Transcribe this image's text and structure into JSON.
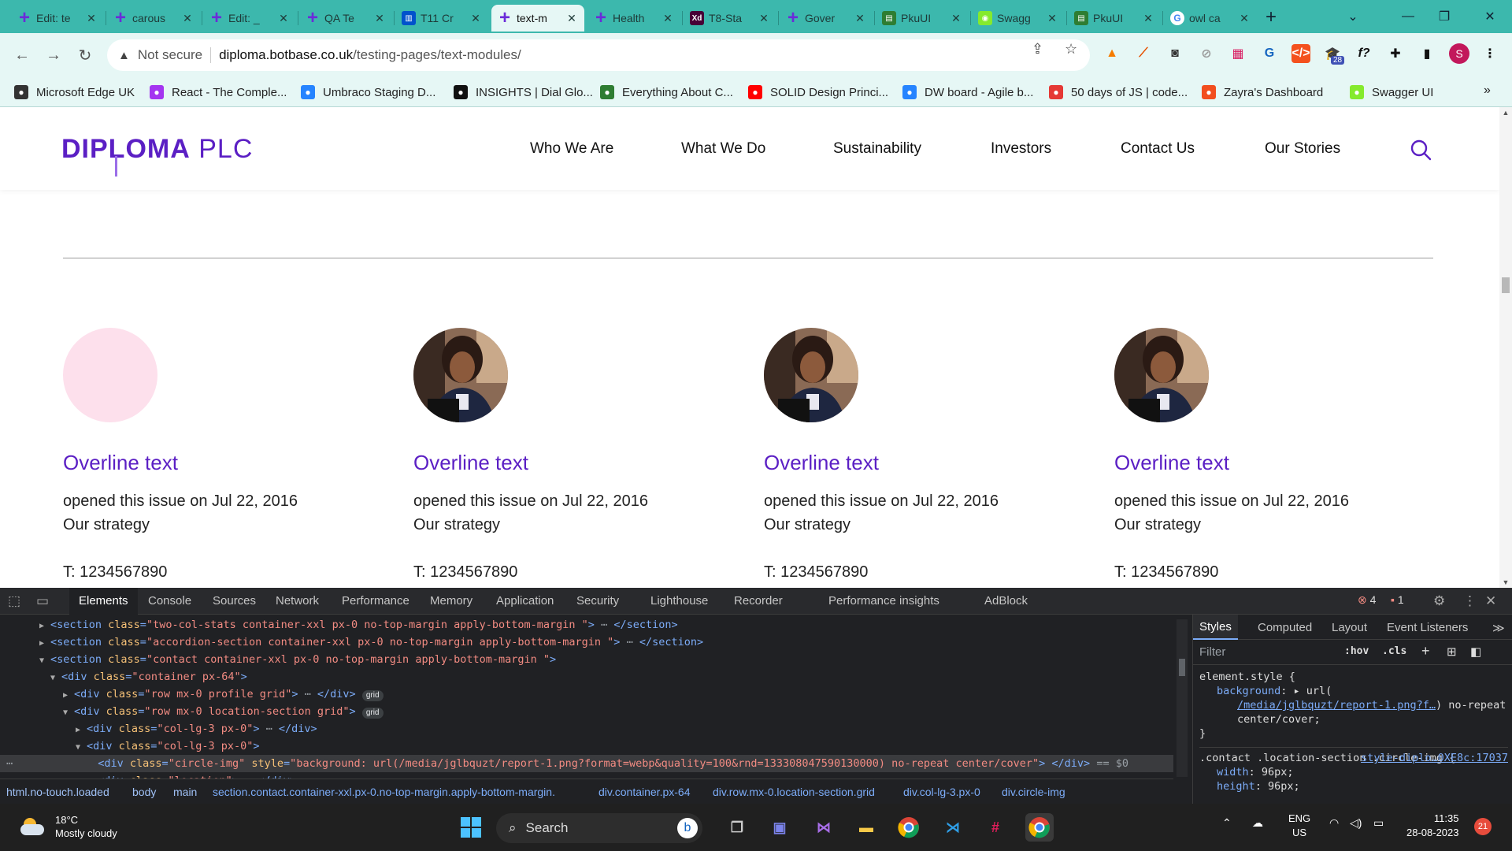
{
  "browser": {
    "tabs": [
      {
        "title": "Edit: te",
        "icon": "plus-icon",
        "color": "#6b2bd9"
      },
      {
        "title": "carous",
        "icon": "plus-icon",
        "color": "#6b2bd9"
      },
      {
        "title": "Edit: _",
        "icon": "plus-icon",
        "color": "#6b2bd9"
      },
      {
        "title": "QA Te",
        "icon": "plus-icon",
        "color": "#6b2bd9"
      },
      {
        "title": "T11 Cr",
        "icon": "trello-icon",
        "color": "#0052cc"
      },
      {
        "title": "text-m",
        "icon": "plus-icon",
        "color": "#6b2bd9",
        "active": true
      },
      {
        "title": "Health",
        "icon": "plus-icon",
        "color": "#6b2bd9"
      },
      {
        "title": "T8-Sta",
        "icon": "xd-icon",
        "color": "#470137"
      },
      {
        "title": "Gover",
        "icon": "plus-icon",
        "color": "#6b2bd9"
      },
      {
        "title": "PkuUI",
        "icon": "pku-icon",
        "color": "#2e7d32"
      },
      {
        "title": "Swagg",
        "icon": "swagger-icon",
        "color": "#85ea2d"
      },
      {
        "title": "PkuUI",
        "icon": "pku-icon",
        "color": "#2e7d32"
      },
      {
        "title": "owl ca",
        "icon": "google-icon",
        "color": "#ffffff"
      }
    ],
    "address": {
      "security_label": "Not secure",
      "host": "diploma.botbase.co.uk",
      "path": "/testing-pages/text-modules/"
    },
    "extension_badge": "28",
    "profile_initial": "S",
    "bookmarks": [
      {
        "label": "Microsoft Edge UK",
        "color": "#333333"
      },
      {
        "label": "React - The Comple...",
        "color": "#a435f0"
      },
      {
        "label": "Umbraco Staging D...",
        "color": "#2684ff"
      },
      {
        "label": "INSIGHTS | Dial Glo...",
        "color": "#111111"
      },
      {
        "label": "Everything About C...",
        "color": "#2e7d32"
      },
      {
        "label": "SOLID Design Princi...",
        "color": "#ff0000"
      },
      {
        "label": "DW board - Agile b...",
        "color": "#2684ff"
      },
      {
        "label": "50 days of JS | code...",
        "color": "#e53935"
      },
      {
        "label": "Zayra's Dashboard",
        "color": "#f24e1e"
      },
      {
        "label": "Swagger UI",
        "color": "#85ea2d"
      }
    ],
    "bookmark_overflow": "»"
  },
  "site": {
    "logo_bold": "DIPLOMA",
    "logo_light": "PLC",
    "nav": [
      "Who We Are",
      "What We Do",
      "Sustainability",
      "Investors",
      "Contact Us",
      "Our Stories"
    ],
    "accent": "#5b1fc4",
    "cards": [
      {
        "avatar": "placeholder",
        "overline": "Overline text",
        "line1": "opened this issue on Jul 22, 2016",
        "line2": "Our strategy",
        "phone": "T: 1234567890"
      },
      {
        "avatar": "photo",
        "overline": "Overline text",
        "line1": "opened this issue on Jul 22, 2016",
        "line2": "Our strategy",
        "phone": "T: 1234567890"
      },
      {
        "avatar": "photo",
        "overline": "Overline text",
        "line1": "opened this issue on Jul 22, 2016",
        "line2": "Our strategy",
        "phone": "T: 1234567890"
      },
      {
        "avatar": "photo",
        "overline": "Overline text",
        "line1": "opened this issue on Jul 22, 2016",
        "line2": "Our strategy",
        "phone": "T: 1234567890"
      }
    ]
  },
  "devtools": {
    "tabs": [
      "Elements",
      "Console",
      "Sources",
      "Network",
      "Performance",
      "Memory",
      "Application",
      "Security",
      "Lighthouse",
      "Recorder",
      "Performance insights",
      "AdBlock"
    ],
    "errors": "4",
    "warnings": "1",
    "styles_tabs": [
      "Styles",
      "Computed",
      "Layout",
      "Event Listeners"
    ],
    "filter_placeholder": "Filter",
    "hov": ":hov",
    "cls": ".cls",
    "breadcrumbs": [
      "html.no-touch.loaded",
      "body",
      "main",
      "section.contact.container-xxl.px-0.no-top-margin.apply-bottom-margin.",
      "div.container.px-64",
      "div.row.mx-0.location-section.grid",
      "div.col-lg-3.px-0",
      "div.circle-img"
    ],
    "dom": {
      "l1_class": "two-col-stats container-xxl px-0  no-top-margin   apply-bottom-margin ",
      "l2_class": "accordion-section container-xxl px-0  no-top-margin   apply-bottom-margin ",
      "l3_class": "contact container-xxl px-0  no-top-margin   apply-bottom-margin ",
      "l4_class": "container px-64",
      "l5_class": "row mx-0 profile grid",
      "l6_class": "row mx-0 location-section grid",
      "l7_class": "col-lg-3 px-0",
      "l8_class": "col-lg-3 px-0",
      "l9_class": "circle-img",
      "l9_style": "background: url(/media/jglbquzt/report-1.png?format=webp&quality=100&rnd=133308047590130000) no-repeat center/cover",
      "l9_suffix": "== $0",
      "l10_class": "location",
      "grid_pill": "grid"
    },
    "styles": {
      "element_style": "element.style {",
      "bg_prop": "background",
      "bg_url_prefix": "url(",
      "bg_url_link": "/media/jglbquzt/report-1.png?f…",
      "bg_url_suffix": ") no-repeat center/cover;",
      "close": "}",
      "selector": ".contact .location-section .circle-img {",
      "source": "style-diplo…0XE8c:17037",
      "width_prop": "width",
      "width_val": "96px;",
      "height_prop": "height",
      "height_val": "96px;"
    }
  },
  "taskbar": {
    "temp": "18°C",
    "weather": "Mostly cloudy",
    "search": "Search",
    "lang1": "ENG",
    "lang2": "US",
    "time": "11:35",
    "date": "28-08-2023",
    "notif": "21"
  }
}
